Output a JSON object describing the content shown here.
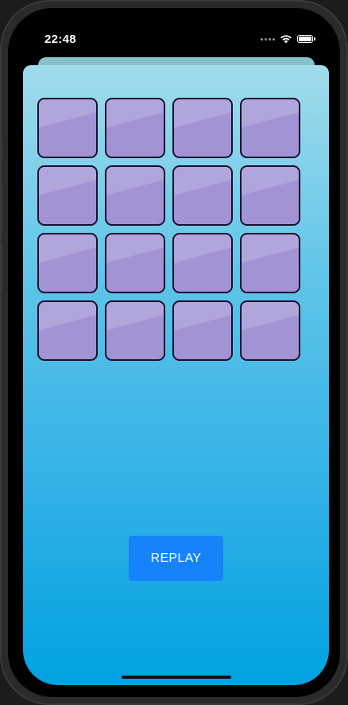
{
  "status_bar": {
    "time": "22:48",
    "icons": [
      "cellular-signal-icon",
      "wifi-icon",
      "battery-icon"
    ]
  },
  "game": {
    "tiles": [
      {
        "id": 1,
        "state": "face-down"
      },
      {
        "id": 2,
        "state": "face-down"
      },
      {
        "id": 3,
        "state": "face-down"
      },
      {
        "id": 4,
        "state": "face-down"
      },
      {
        "id": 5,
        "state": "face-down"
      },
      {
        "id": 6,
        "state": "face-down"
      },
      {
        "id": 7,
        "state": "face-down"
      },
      {
        "id": 8,
        "state": "face-down"
      },
      {
        "id": 9,
        "state": "face-down"
      },
      {
        "id": 10,
        "state": "face-down"
      },
      {
        "id": 11,
        "state": "face-down"
      },
      {
        "id": 12,
        "state": "face-down"
      },
      {
        "id": 13,
        "state": "face-down"
      },
      {
        "id": 14,
        "state": "face-down"
      },
      {
        "id": 15,
        "state": "face-down"
      },
      {
        "id": 16,
        "state": "face-down"
      }
    ],
    "replay_label": "REPLAY"
  },
  "colors": {
    "background_top": "#a1dceb",
    "background_bottom": "#00a2e1",
    "tile_light": "#b1a6dc",
    "tile_dark": "#a293d4",
    "tile_border": "#1a1030",
    "button": "#1683fb"
  }
}
